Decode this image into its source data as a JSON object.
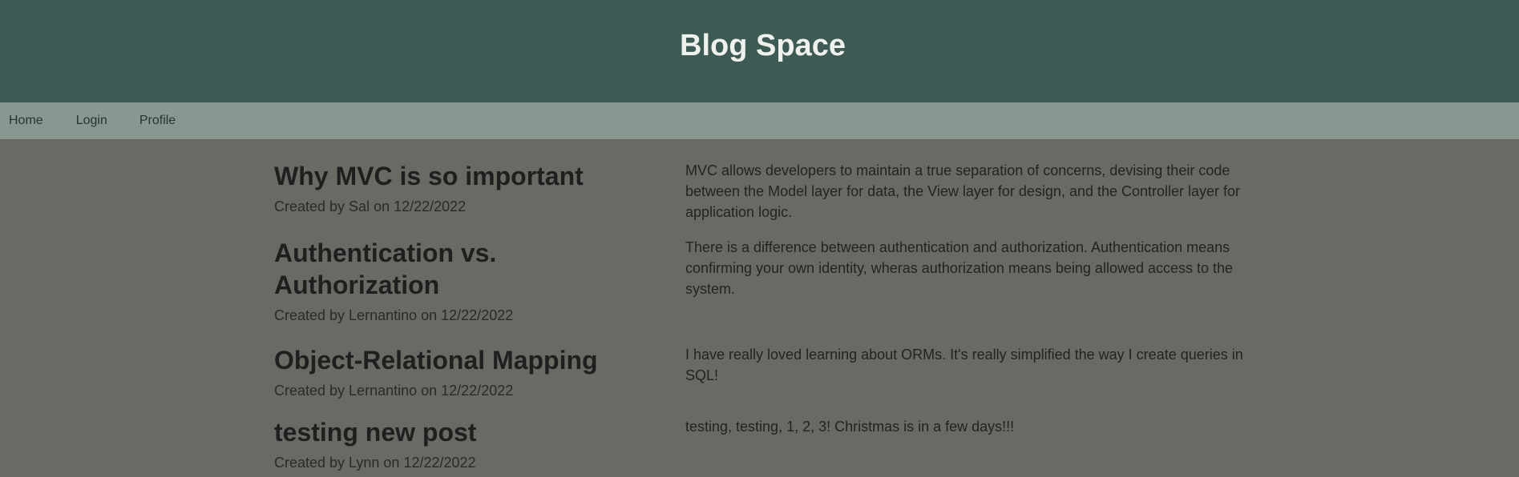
{
  "header": {
    "title": "Blog Space"
  },
  "nav": {
    "items": [
      "Home",
      "Login",
      "Profile"
    ]
  },
  "posts": [
    {
      "title": "Why MVC is so important",
      "meta": "Created by Sal on 12/22/2022",
      "body": "MVC allows developers to maintain a true separation of concerns, devising their code between the Model layer for data, the View layer for design, and the Controller layer for application logic."
    },
    {
      "title": "Authentication vs. Authorization",
      "meta": "Created by Lernantino on 12/22/2022",
      "body": "There is a difference between authentication and authorization. Authentication means confirming your own identity, wheras authorization means being allowed access to the system."
    },
    {
      "title": "Object-Relational Mapping",
      "meta": "Created by Lernantino on 12/22/2022",
      "body": "I have really loved learning about ORMs. It's really simplified the way I create queries in SQL!"
    },
    {
      "title": "testing new post",
      "meta": "Created by Lynn on 12/22/2022",
      "body": "testing, testing, 1, 2, 3! Christmas is in a few days!!!"
    }
  ]
}
